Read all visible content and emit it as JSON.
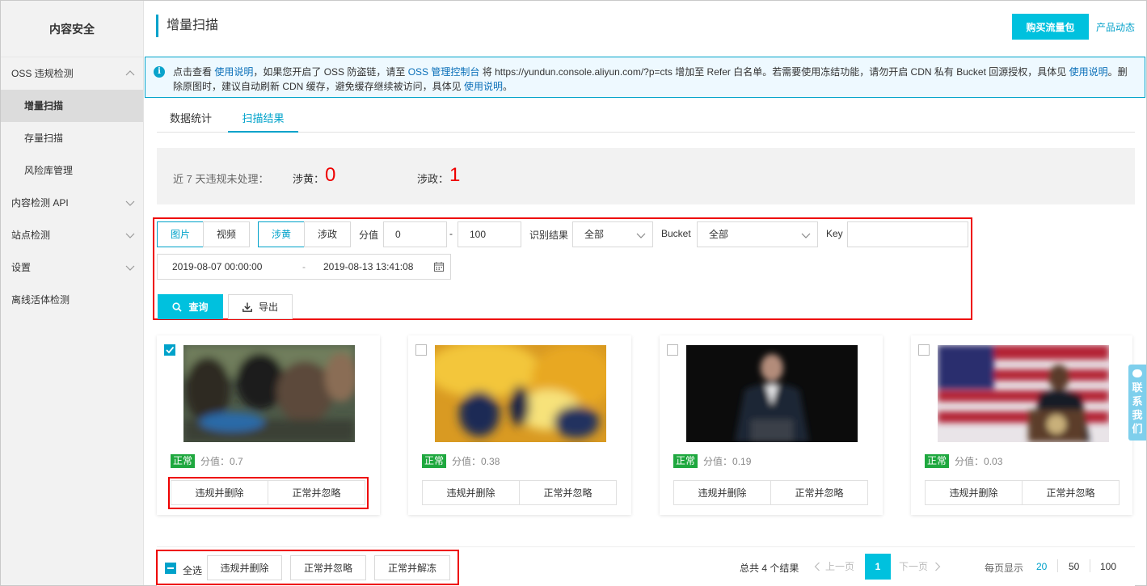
{
  "sidebar": {
    "brand": "内容安全",
    "items": [
      {
        "label": "OSS 违规检测",
        "chevron": "up"
      },
      {
        "label": "增量扫描",
        "active": true
      },
      {
        "label": "存量扫描"
      },
      {
        "label": "风险库管理"
      },
      {
        "label": "内容检测 API",
        "chevron": "down"
      },
      {
        "label": "站点检测",
        "chevron": "down"
      },
      {
        "label": "设置",
        "chevron": "down"
      },
      {
        "label": "离线活体检测"
      }
    ]
  },
  "header": {
    "title": "增量扫描",
    "buy_label": "购买流量包",
    "news_label": "产品动态"
  },
  "notice": {
    "p1": "点击查看 ",
    "link1": "使用说明",
    "p2": "，如果您开启了 OSS 防盗链，请至 ",
    "link2": "OSS 管理控制台",
    "p3": " 将 https://yundun.console.aliyun.com/?p=cts 增加至 Refer 白名单。若需要使用冻结功能，请勿开启 CDN 私有 Bucket 回源授权，具体见 ",
    "link3": "使用说明",
    "p4": "。删除原图时，建议自动刷新 CDN 缓存，避免缓存继续被访问，具体见 ",
    "link4": "使用说明",
    "p5": "。"
  },
  "tabs": [
    {
      "label": "数据统计"
    },
    {
      "label": "扫描结果",
      "active": true
    }
  ],
  "stats": {
    "label": "近 7 天违规未处理：",
    "porn_label": "涉黄：",
    "porn_value": "0",
    "politics_label": "涉政：",
    "politics_value": "1"
  },
  "filter": {
    "media_types": [
      "图片",
      "视频"
    ],
    "media_selected": "图片",
    "scenes": [
      "涉黄",
      "涉政"
    ],
    "scene_selected": "涉黄",
    "score_label": "分值",
    "score_min": "0",
    "score_sep": "-",
    "score_max": "100",
    "result_label": "识别结果",
    "result_value": "全部",
    "bucket_label": "Bucket",
    "bucket_value": "全部",
    "key_label": "Key",
    "key_value": "",
    "date_start": "2019-08-07 00:00:00",
    "date_sep": "-",
    "date_end": "2019-08-13 13:41:08",
    "query_label": "查询",
    "export_label": "导出"
  },
  "cards": [
    {
      "checked": true,
      "status": "正常",
      "score_label": "分值：",
      "score": "0.7",
      "delete_label": "违规并删除",
      "ignore_label": "正常并忽略"
    },
    {
      "checked": false,
      "status": "正常",
      "score_label": "分值：",
      "score": "0.38",
      "delete_label": "违规并删除",
      "ignore_label": "正常并忽略"
    },
    {
      "checked": false,
      "status": "正常",
      "score_label": "分值：",
      "score": "0.19",
      "delete_label": "违规并删除",
      "ignore_label": "正常并忽略"
    },
    {
      "checked": false,
      "status": "正常",
      "score_label": "分值：",
      "score": "0.03",
      "delete_label": "违规并删除",
      "ignore_label": "正常并忽略"
    }
  ],
  "bulk": {
    "select_all": "全选",
    "delete_label": "违规并删除",
    "ignore_label": "正常并忽略",
    "unfreeze_label": "正常并解冻"
  },
  "pager": {
    "total": "总共 4 个结果",
    "prev": "上一页",
    "current": "1",
    "next": "下一页",
    "page_size_label": "每页显示",
    "sizes": [
      "20",
      "50",
      "100"
    ],
    "size_selected": "20"
  },
  "contact": {
    "chars": [
      "联",
      "系",
      "我",
      "们"
    ]
  },
  "colors": {
    "accent": "#00c1de",
    "link": "#0aa3cb",
    "danger": "#ee0000",
    "ok": "#1fa83f"
  }
}
